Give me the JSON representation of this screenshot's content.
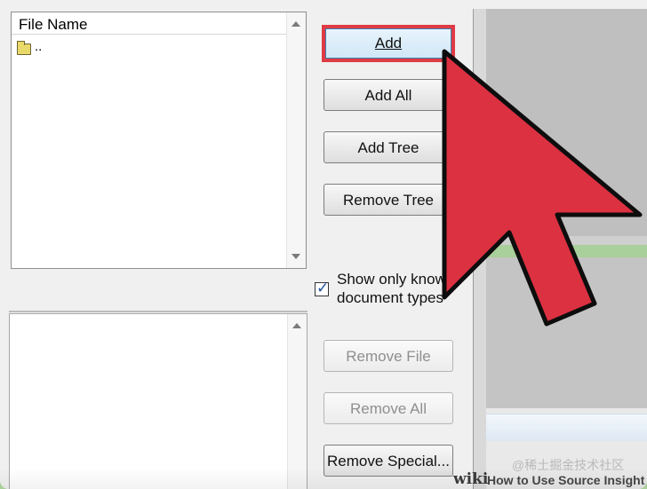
{
  "file_list": {
    "header": "File Name",
    "items": [
      {
        "label": ".."
      }
    ]
  },
  "buttons": {
    "add": "Add",
    "add_all": "Add All",
    "add_tree": "Add Tree",
    "remove_tree": "Remove Tree",
    "remove_file": "Remove File",
    "remove_all": "Remove All",
    "remove_special": "Remove Special..."
  },
  "checkbox": {
    "label_line1": "Show only know",
    "label_line2": "document types",
    "checked": true
  },
  "footer": {
    "logo": "wiki",
    "caption": "How to Use Source Insight",
    "watermark": "@稀土掘金技术社区"
  },
  "colors": {
    "highlight": "#e03b45",
    "cursor_fill": "#dc3141",
    "background_green": "#a9cf9a"
  },
  "icons": {
    "folder": "folder-icon",
    "cursor": "pointer-cursor-icon"
  }
}
